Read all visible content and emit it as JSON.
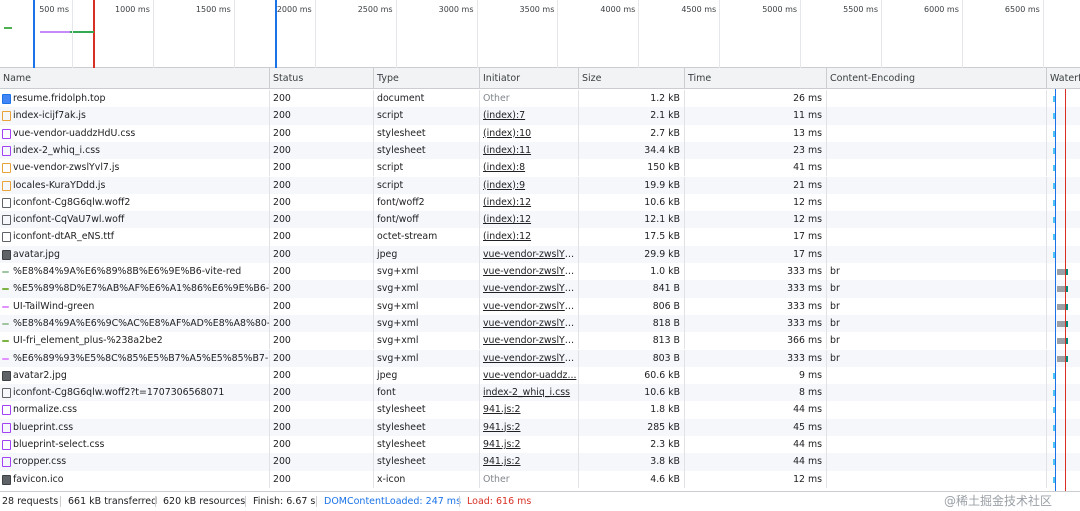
{
  "overview": {
    "ticks": [
      "500 ms",
      "1000 ms",
      "1500 ms",
      "2000 ms",
      "2500 ms",
      "3000 ms",
      "3500 ms",
      "4000 ms",
      "4500 ms",
      "5000 ms",
      "5500 ms",
      "6000 ms",
      "6500 ms"
    ]
  },
  "columns": {
    "name": "Name",
    "status": "Status",
    "type": "Type",
    "initiator": "Initiator",
    "size": "Size",
    "time": "Time",
    "encoding": "Content-Encoding",
    "waterfall": "Waterfall"
  },
  "rows": [
    {
      "name": "resume.fridolph.top",
      "status": "200",
      "type": "document",
      "initiator": "Other",
      "size": "1.2 kB",
      "time": "26 ms",
      "encoding": "",
      "icon": "document-icon"
    },
    {
      "name": "index-icijf7ak.js",
      "status": "200",
      "type": "script",
      "initiator": "(index):7",
      "size": "2.1 kB",
      "time": "11 ms",
      "encoding": "",
      "icon": "script-icon"
    },
    {
      "name": "vue-vendor-uaddzHdU.css",
      "status": "200",
      "type": "stylesheet",
      "initiator": "(index):10",
      "size": "2.7 kB",
      "time": "13 ms",
      "encoding": "",
      "icon": "stylesheet-icon"
    },
    {
      "name": "index-2_whiq_i.css",
      "status": "200",
      "type": "stylesheet",
      "initiator": "(index):11",
      "size": "34.4 kB",
      "time": "23 ms",
      "encoding": "",
      "icon": "stylesheet-icon"
    },
    {
      "name": "vue-vendor-zwslYvl7.js",
      "status": "200",
      "type": "script",
      "initiator": "(index):8",
      "size": "150 kB",
      "time": "41 ms",
      "encoding": "",
      "icon": "script-icon"
    },
    {
      "name": "locales-KuraYDdd.js",
      "status": "200",
      "type": "script",
      "initiator": "(index):9",
      "size": "19.9 kB",
      "time": "21 ms",
      "encoding": "",
      "icon": "script-icon"
    },
    {
      "name": "iconfont-Cg8G6qlw.woff2",
      "status": "200",
      "type": "font/woff2",
      "initiator": "(index):12",
      "size": "10.6 kB",
      "time": "12 ms",
      "encoding": "",
      "icon": "font-icon"
    },
    {
      "name": "iconfont-CqVaU7wl.woff",
      "status": "200",
      "type": "font/woff",
      "initiator": "(index):12",
      "size": "12.1 kB",
      "time": "12 ms",
      "encoding": "",
      "icon": "font-icon"
    },
    {
      "name": "iconfont-dtAR_eNS.ttf",
      "status": "200",
      "type": "octet-stream",
      "initiator": "(index):12",
      "size": "17.5 kB",
      "time": "17 ms",
      "encoding": "",
      "icon": "font-icon"
    },
    {
      "name": "avatar.jpg",
      "status": "200",
      "type": "jpeg",
      "initiator": "vue-vendor-zwslYv...",
      "size": "29.9 kB",
      "time": "17 ms",
      "encoding": "",
      "icon": "image-icon"
    },
    {
      "name": "%E8%84%9A%E6%89%8B%E6%9E%B6-vite-red",
      "status": "200",
      "type": "svg+xml",
      "initiator": "vue-vendor-zwslYv...",
      "size": "1.0 kB",
      "time": "333 ms",
      "encoding": "br",
      "icon": "svg-icon"
    },
    {
      "name": "%E5%89%8D%E7%AB%AF%E6%A1%86%E6%9E%B6-Vu...",
      "status": "200",
      "type": "svg+xml",
      "initiator": "vue-vendor-zwslYv...",
      "size": "841 B",
      "time": "333 ms",
      "encoding": "br",
      "icon": "svg-icon"
    },
    {
      "name": "UI-TailWind-green",
      "status": "200",
      "type": "svg+xml",
      "initiator": "vue-vendor-zwslYv...",
      "size": "806 B",
      "time": "333 ms",
      "encoding": "br",
      "icon": "svg-icon"
    },
    {
      "name": "%E8%84%9A%E6%9C%AC%E8%AF%AD%E8%A8%80-T...",
      "status": "200",
      "type": "svg+xml",
      "initiator": "vue-vendor-zwslYv...",
      "size": "818 B",
      "time": "333 ms",
      "encoding": "br",
      "icon": "svg-icon"
    },
    {
      "name": "UI-fri_element_plus-%238a2be2",
      "status": "200",
      "type": "svg+xml",
      "initiator": "vue-vendor-zwslYv...",
      "size": "813 B",
      "time": "366 ms",
      "encoding": "br",
      "icon": "svg-icon"
    },
    {
      "name": "%E6%89%93%E5%8C%85%E5%B7%A5%E5%85%B7-Rol...",
      "status": "200",
      "type": "svg+xml",
      "initiator": "vue-vendor-zwslYv...",
      "size": "803 B",
      "time": "333 ms",
      "encoding": "br",
      "icon": "svg-icon"
    },
    {
      "name": "avatar2.jpg",
      "status": "200",
      "type": "jpeg",
      "initiator": "vue-vendor-uaddz...",
      "size": "60.6 kB",
      "time": "9 ms",
      "encoding": "",
      "icon": "image-icon"
    },
    {
      "name": "iconfont-Cg8G6qlw.woff2?t=1707306568071",
      "status": "200",
      "type": "font",
      "initiator": "index-2_whiq_i.css",
      "size": "10.6 kB",
      "time": "8 ms",
      "encoding": "",
      "icon": "font-icon"
    },
    {
      "name": "normalize.css",
      "status": "200",
      "type": "stylesheet",
      "initiator": "941.js:2",
      "size": "1.8 kB",
      "time": "44 ms",
      "encoding": "",
      "icon": "stylesheet-icon"
    },
    {
      "name": "blueprint.css",
      "status": "200",
      "type": "stylesheet",
      "initiator": "941.js:2",
      "size": "285 kB",
      "time": "45 ms",
      "encoding": "",
      "icon": "stylesheet-icon"
    },
    {
      "name": "blueprint-select.css",
      "status": "200",
      "type": "stylesheet",
      "initiator": "941.js:2",
      "size": "2.3 kB",
      "time": "44 ms",
      "encoding": "",
      "icon": "stylesheet-icon"
    },
    {
      "name": "cropper.css",
      "status": "200",
      "type": "stylesheet",
      "initiator": "941.js:2",
      "size": "3.8 kB",
      "time": "44 ms",
      "encoding": "",
      "icon": "stylesheet-icon"
    },
    {
      "name": "favicon.ico",
      "status": "200",
      "type": "x-icon",
      "initiator": "Other",
      "size": "4.6 kB",
      "time": "12 ms",
      "encoding": "",
      "icon": "image-icon"
    }
  ],
  "footer": {
    "requests": "28 requests",
    "transferred": "661 kB transferred",
    "resources": "620 kB resources",
    "finish": "Finish: 6.67 s",
    "dcl": "DOMContentLoaded: 247 ms",
    "load": "Load: 616 ms",
    "watermark": "@稀土掘金技术社区"
  },
  "colors": {
    "dcl": "#1a73e8",
    "load": "#d93025",
    "link_text": "#202124"
  }
}
